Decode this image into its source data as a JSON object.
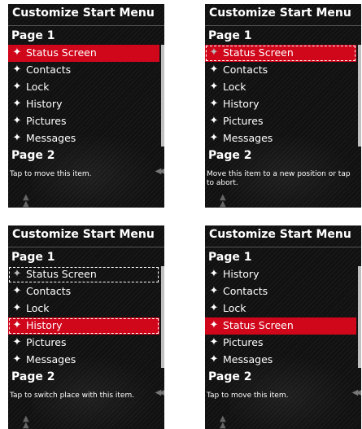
{
  "panels": [
    {
      "title": "Customize Start Menu",
      "page1": "Page 1",
      "page2": "Page 2",
      "items": [
        "Status Screen",
        "Contacts",
        "Lock",
        "History",
        "Pictures",
        "Messages"
      ],
      "hint": "Tap to move this item."
    },
    {
      "title": "Customize Start Menu",
      "page1": "Page 1",
      "page2": "Page 2",
      "items": [
        "Status Screen",
        "Contacts",
        "Lock",
        "History",
        "Pictures",
        "Messages"
      ],
      "hint": "Move this item to a new position or tap to abort."
    },
    {
      "title": "Customize Start Menu",
      "page1": "Page 1",
      "page2": "Page 2",
      "items": [
        "Status Screen",
        "Contacts",
        "Lock",
        "History",
        "Pictures",
        "Messages"
      ],
      "hint": "Tap to switch place with this item."
    },
    {
      "title": "Customize Start Menu",
      "page1": "Page 1",
      "page2": "Page 2",
      "items": [
        "History",
        "Contacts",
        "Lock",
        "Status Screen",
        "Pictures",
        "Messages"
      ],
      "hint": "Tap to move this item."
    }
  ],
  "colors": {
    "highlight": "#d0061b",
    "background": "#111111",
    "text": "#ffffff"
  },
  "icons": {
    "item_icon": "star-sparkle-icon"
  }
}
